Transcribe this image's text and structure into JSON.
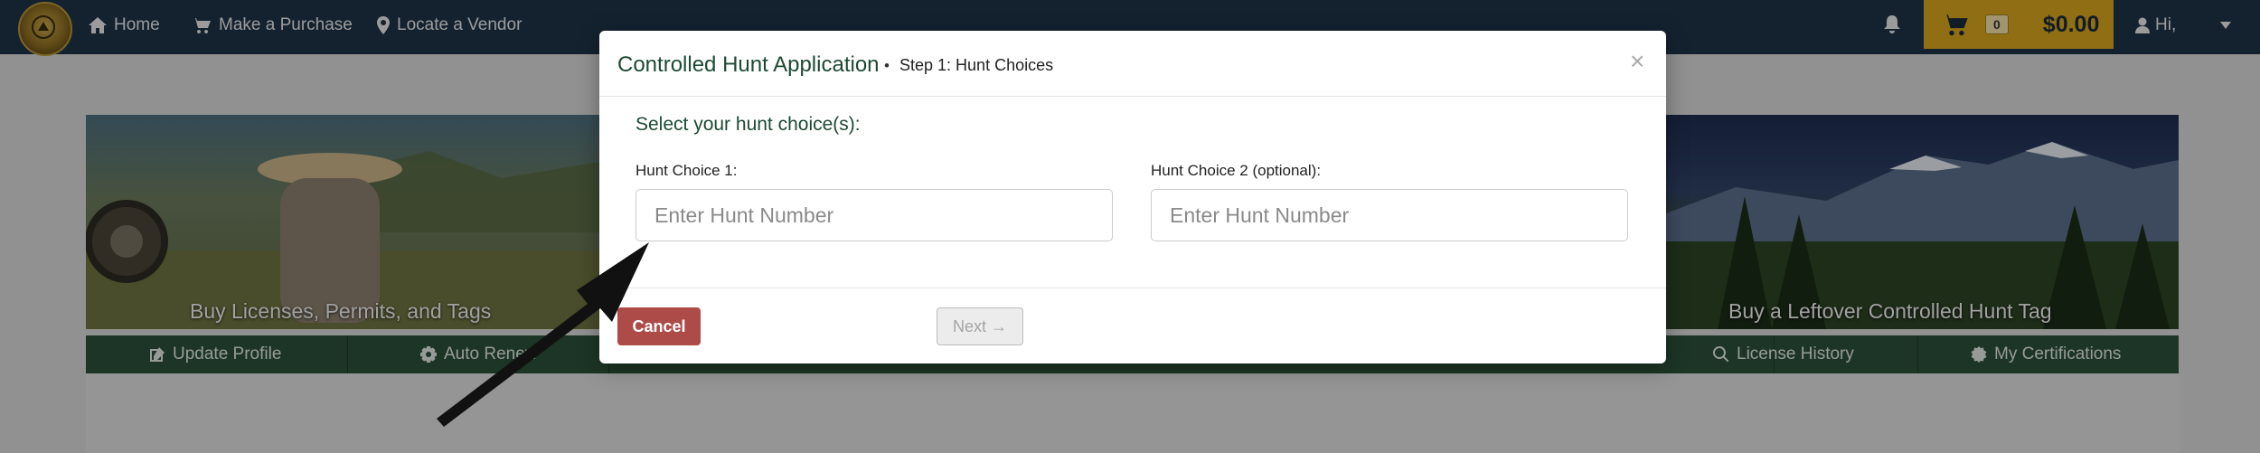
{
  "nav": {
    "home_label": "Home",
    "purchase_label": "Make a Purchase",
    "vendor_label": "Locate a Vendor",
    "cart_count": "0",
    "cart_total": "$0.00",
    "user_label": "Hi,"
  },
  "banner": {
    "left_caption": "Buy Licenses, Permits, and Tags",
    "right_caption": "Buy a Leftover Controlled Hunt Tag"
  },
  "profile_bar": {
    "items": [
      {
        "label": "Update Profile",
        "icon": "edit-icon"
      },
      {
        "label": "Auto Renew",
        "icon": "gear-icon"
      },
      {
        "label": "License History",
        "icon": "search-icon"
      },
      {
        "label": "My Certifications",
        "icon": "certificate-icon"
      }
    ]
  },
  "modal": {
    "title": "Controlled Hunt Application",
    "separator": "•",
    "step": "Step 1: Hunt Choices",
    "close_symbol": "×",
    "section_heading": "Select your hunt choice(s):",
    "choice1": {
      "label": "Hunt Choice 1:",
      "placeholder": "Enter Hunt Number",
      "value": ""
    },
    "choice2": {
      "label": "Hunt Choice 2 (optional):",
      "placeholder": "Enter Hunt Number",
      "value": ""
    },
    "cancel_label": "Cancel",
    "next_label": "Next →"
  },
  "colors": {
    "nav_bg": "#1f3348",
    "cart_bg": "#d5a41f",
    "green_bar": "#2b4f39",
    "cancel_bg": "#ad4b48",
    "title_green": "#1d4a33"
  }
}
